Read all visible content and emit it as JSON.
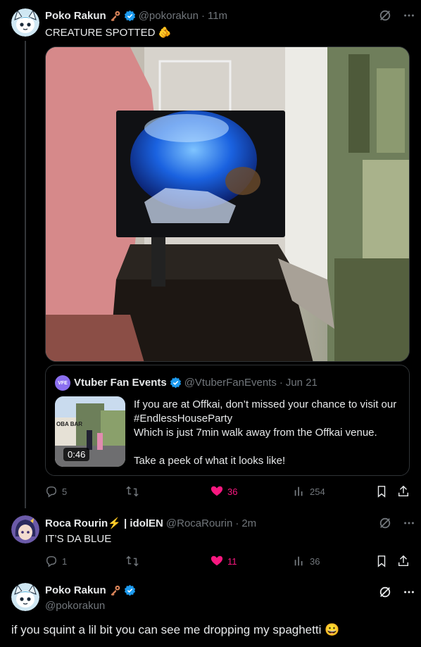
{
  "tweet1": {
    "author": "Poko Rakun",
    "handle": "@pokorakun",
    "time": "11m",
    "text": "CREATURE SPOTTED",
    "emoji": "🫵",
    "quote": {
      "author": "Vtuber Fan Events",
      "handle": "@VtuberFanEvents",
      "date": "Jun 21",
      "avatar_text": "VFE",
      "line1": "If you are at Offkai, don’t missed your chance to visit our",
      "line2": "#EndlessHouseParty",
      "line3": "Which is just 7min walk away from the Offkai venue.",
      "line4": "Take a peek of what it looks like!",
      "thumb_sign": "OBA BAR",
      "duration": "0:46"
    },
    "actions": {
      "replies": "5",
      "retweets": "",
      "likes": "36",
      "views": "254"
    }
  },
  "tweet2": {
    "author": "Roca Rourin⚡ | idolEN",
    "handle": "@RocaRourin",
    "time": "2m",
    "text": "IT’S DA BLUE",
    "actions": {
      "replies": "1",
      "retweets": "",
      "likes": "11",
      "views": "36"
    }
  },
  "tweet3": {
    "author": "Poko Rakun",
    "handle": "@pokorakun",
    "text": "if you squint a lil bit you can see me dropping my spaghetti",
    "emoji": "😀"
  },
  "colors": {
    "accent": "#1d9bf0",
    "like": "#f91880",
    "muted": "#71767b",
    "border": "#2f3336"
  },
  "icons": [
    "verified-badge",
    "key-icon",
    "grok-icon",
    "more-icon",
    "reply-icon",
    "retweet-icon",
    "like-icon",
    "views-icon",
    "bookmark-icon",
    "share-icon"
  ]
}
